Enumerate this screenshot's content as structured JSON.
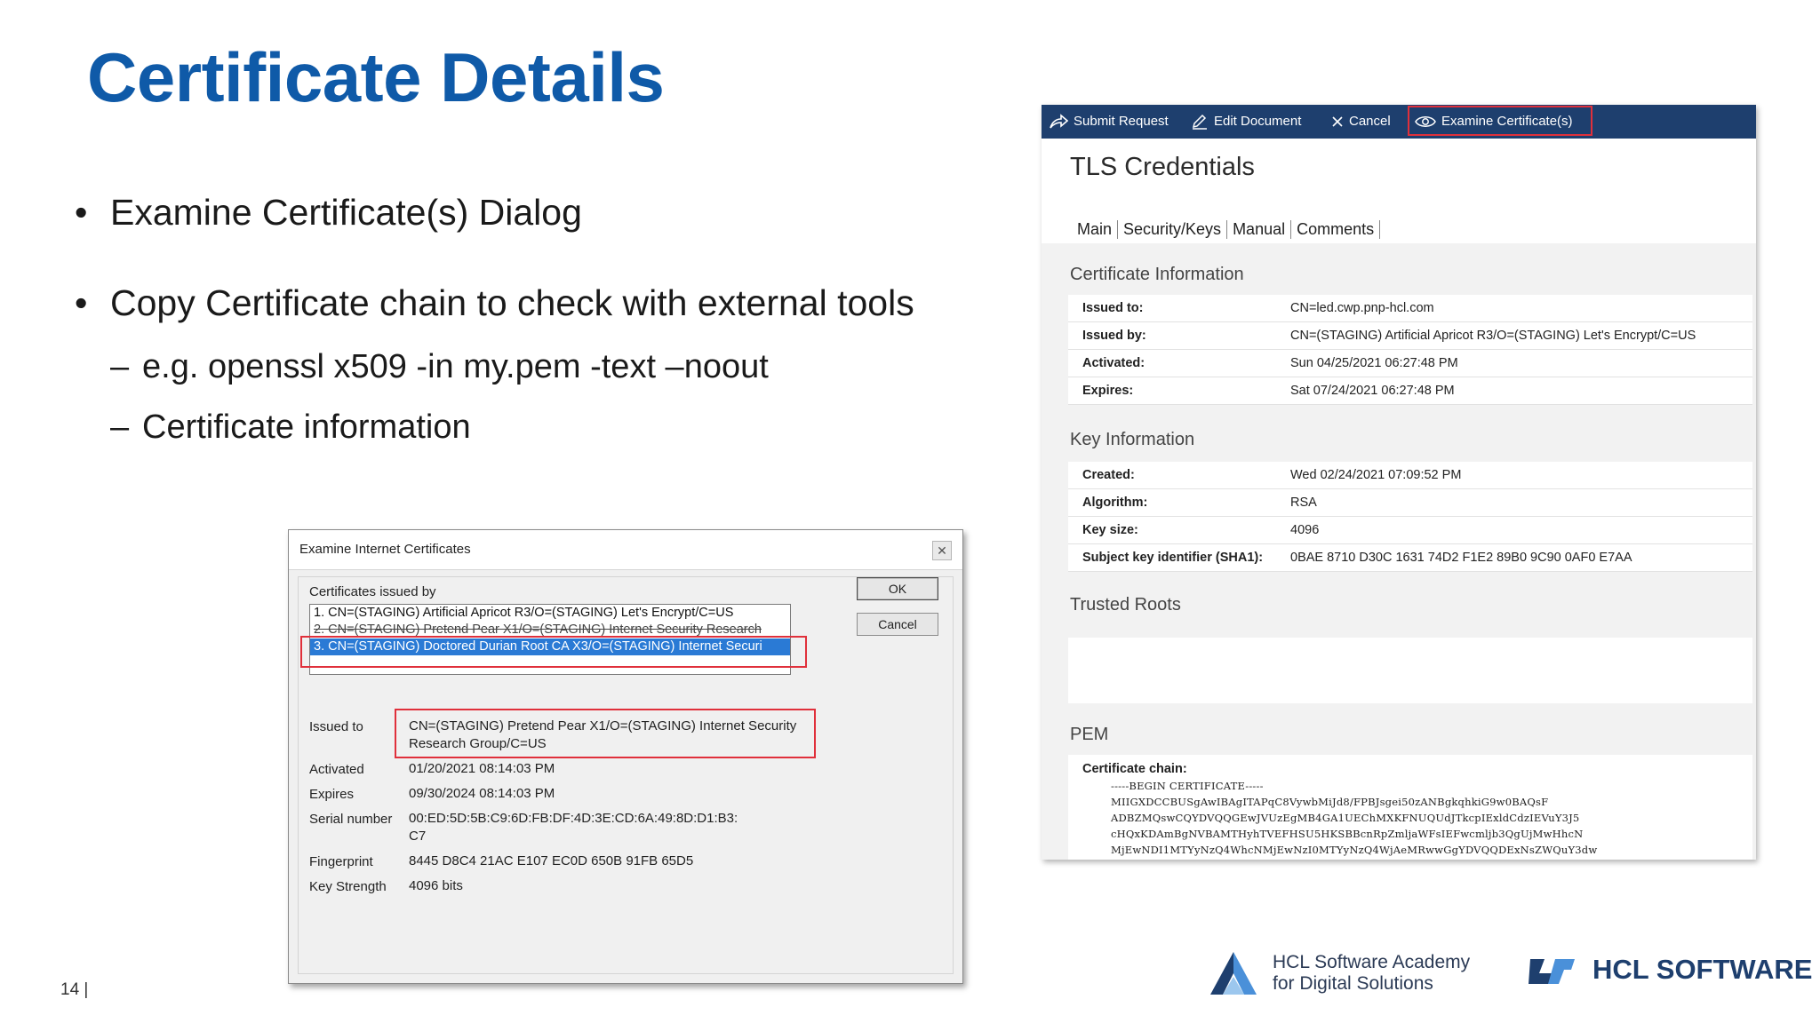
{
  "slide": {
    "title": "Certificate Details",
    "bullets": [
      "Examine Certificate(s) Dialog",
      "Copy Certificate chain to check with external tools"
    ],
    "sub_bullets": [
      "e.g. openssl x509 -in my.pem -text –noout",
      "Certificate information"
    ],
    "bullet_glyph": "•",
    "dash_glyph": "–",
    "page_number": "14  |"
  },
  "dialog": {
    "title": "Examine Internet Certificates",
    "close_glyph": "✕",
    "issued_by_label": "Certificates issued by",
    "certificates": [
      "1. CN=(STAGING) Artificial Apricot R3/O=(STAGING) Let's Encrypt/C=US",
      "2. CN=(STAGING) Pretend Pear X1/O=(STAGING) Internet Security Research",
      "3. CN=(STAGING) Doctored Durian Root CA X3/O=(STAGING) Internet Securi"
    ],
    "ok_label": "OK",
    "cancel_label": "Cancel",
    "fields": {
      "issued_to_label": "Issued to",
      "issued_to_line1": "CN=(STAGING) Pretend Pear X1/O=(STAGING) Internet Security",
      "issued_to_line2": "Research Group/C=US",
      "activated_label": "Activated",
      "activated": "01/20/2021 08:14:03 PM",
      "expires_label": "Expires",
      "expires": "09/30/2024 08:14:03 PM",
      "serial_label": "Serial number",
      "serial_line1": "00:ED:5D:5B:C9:6D:FB:DF:4D:3E:CD:6A:49:8D:D1:B3:",
      "serial_line2": "C7",
      "fingerprint_label": "Fingerprint",
      "fingerprint": "8445 D8C4 21AC E107 EC0D 650B 91FB 65D5",
      "key_strength_label": "Key Strength",
      "key_strength": "4096 bits"
    }
  },
  "webapp": {
    "toolbar": {
      "submit": "Submit Request",
      "edit": "Edit Document",
      "cancel": "Cancel",
      "examine": "Examine Certificate(s)"
    },
    "title": "TLS Credentials",
    "tabs": [
      "Main",
      "Security/Keys",
      "Manual",
      "Comments"
    ],
    "certificate_info": {
      "heading": "Certificate Information",
      "rows": [
        {
          "key": "Issued to:",
          "value": "CN=led.cwp.pnp-hcl.com"
        },
        {
          "key": "Issued by:",
          "value": "CN=(STAGING) Artificial Apricot R3/O=(STAGING) Let's Encrypt/C=US"
        },
        {
          "key": "Activated:",
          "value": "Sun 04/25/2021 06:27:48 PM"
        },
        {
          "key": "Expires:",
          "value": "Sat 07/24/2021 06:27:48 PM"
        }
      ]
    },
    "key_info": {
      "heading": "Key Information",
      "rows": [
        {
          "key": "Created:",
          "value": "Wed 02/24/2021 07:09:52 PM"
        },
        {
          "key": "Algorithm:",
          "value": "RSA"
        },
        {
          "key": "Key size:",
          "value": "4096"
        },
        {
          "key": "Subject key identifier (SHA1):",
          "value": "0BAE 8710 D30C 1631 74D2 F1E2 89B0 9C90 0AF0 E7AA"
        }
      ]
    },
    "trusted_roots": {
      "heading": "Trusted Roots"
    },
    "pem": {
      "heading": "PEM",
      "chain_label": "Certificate chain:",
      "lines": [
        "-----BEGIN CERTIFICATE-----",
        "MIIGXDCCBUSgAwIBAgITAPqC8VywbMiJd8/FPBJsgei50zANBgkqhkiG9w0BAQsF",
        "ADBZMQswCQYDVQQGEwJVUzEgMB4GA1UEChMXKFNUQUdJTkcpIExldCdzIEVuY3J5",
        "cHQxKDAmBgNVBAMTHyhTVEFHSU5HKSBBcnRpZmljaWFsIEFwcmljb3QgUjMwHhcN",
        "MjEwNDI1MTYyNzQ4WhcNMjEwNzI0MTYyNzQ4WjAeMRwwGgYDVQQDExNsZWQuY3dw"
      ]
    }
  },
  "footer": {
    "academy_line1": "HCL Software Academy",
    "academy_line2": "for Digital Solutions",
    "hcl_brand": "HCL SOFTWARE"
  },
  "colors": {
    "title_blue": "#0f5aa8",
    "toolbar_navy": "#1e3f6e",
    "highlight_red": "#e0303b",
    "selection_blue": "#2a7ad5"
  }
}
